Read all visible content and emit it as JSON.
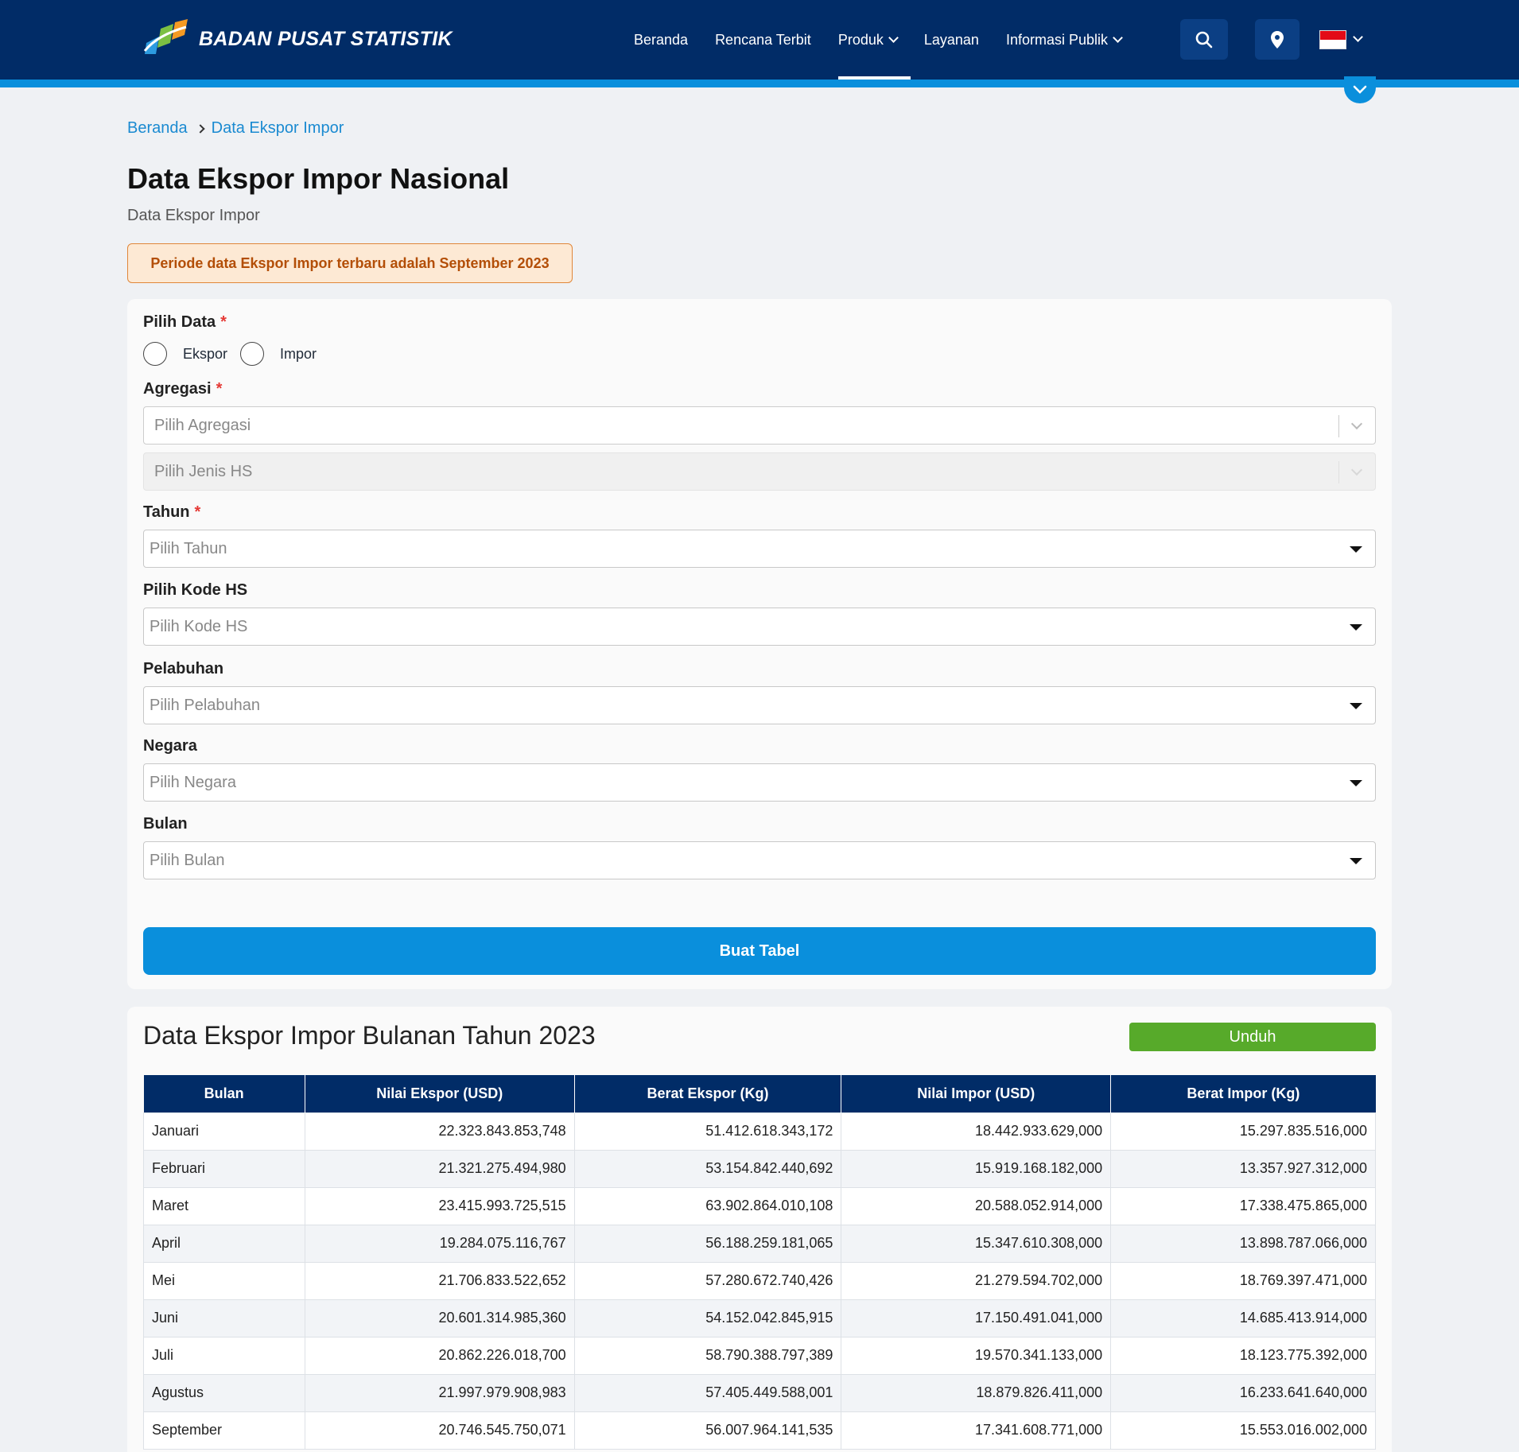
{
  "header": {
    "logo_text": "BADAN PUSAT STATISTIK",
    "nav": [
      {
        "label": "Beranda"
      },
      {
        "label": "Rencana Terbit"
      },
      {
        "label": "Produk"
      },
      {
        "label": "Layanan"
      },
      {
        "label": "Informasi Publik"
      }
    ],
    "accent_color": "#0a8fdc",
    "bar_color": "#012c67"
  },
  "breadcrumb": [
    "Beranda",
    "Data Ekspor Impor"
  ],
  "page": {
    "title": "Data Ekspor Impor Nasional",
    "subtitle": "Data Ekspor Impor",
    "notice": "Periode data Ekspor Impor terbaru adalah September 2023"
  },
  "form": {
    "pilih_data_label": "Pilih Data",
    "radio_options": [
      "Ekspor",
      "Impor"
    ],
    "agregasi_label": "Agregasi",
    "agregasi_placeholder": "Pilih Agregasi",
    "jenis_hs_placeholder": "Pilih Jenis HS",
    "tahun_label": "Tahun",
    "tahun_placeholder": "Pilih Tahun",
    "kode_hs_label": "Pilih Kode HS",
    "kode_hs_placeholder": "Pilih Kode HS",
    "pelabuhan_label": "Pelabuhan",
    "pelabuhan_placeholder": "Pilih Pelabuhan",
    "negara_label": "Negara",
    "negara_placeholder": "Pilih Negara",
    "bulan_label": "Bulan",
    "bulan_placeholder": "Pilih Bulan",
    "submit_label": "Buat Tabel"
  },
  "table_section": {
    "title": "Data Ekspor Impor Bulanan Tahun 2023",
    "download_label": "Unduh",
    "columns": [
      "Bulan",
      "Nilai Ekspor (USD)",
      "Berat Ekspor (Kg)",
      "Nilai Impor (USD)",
      "Berat Impor (Kg)"
    ],
    "rows": [
      [
        "Januari",
        "22.323.843.853,748",
        "51.412.618.343,172",
        "18.442.933.629,000",
        "15.297.835.516,000"
      ],
      [
        "Februari",
        "21.321.275.494,980",
        "53.154.842.440,692",
        "15.919.168.182,000",
        "13.357.927.312,000"
      ],
      [
        "Maret",
        "23.415.993.725,515",
        "63.902.864.010,108",
        "20.588.052.914,000",
        "17.338.475.865,000"
      ],
      [
        "April",
        "19.284.075.116,767",
        "56.188.259.181,065",
        "15.347.610.308,000",
        "13.898.787.066,000"
      ],
      [
        "Mei",
        "21.706.833.522,652",
        "57.280.672.740,426",
        "21.279.594.702,000",
        "18.769.397.471,000"
      ],
      [
        "Juni",
        "20.601.314.985,360",
        "54.152.042.845,915",
        "17.150.491.041,000",
        "14.685.413.914,000"
      ],
      [
        "Juli",
        "20.862.226.018,700",
        "58.790.388.797,389",
        "19.570.341.133,000",
        "18.123.775.392,000"
      ],
      [
        "Agustus",
        "21.997.979.908,983",
        "57.405.449.588,001",
        "18.879.826.411,000",
        "16.233.641.640,000"
      ],
      [
        "September",
        "20.746.545.750,071",
        "56.007.964.141,535",
        "17.341.608.771,000",
        "15.553.016.002,000"
      ]
    ]
  }
}
